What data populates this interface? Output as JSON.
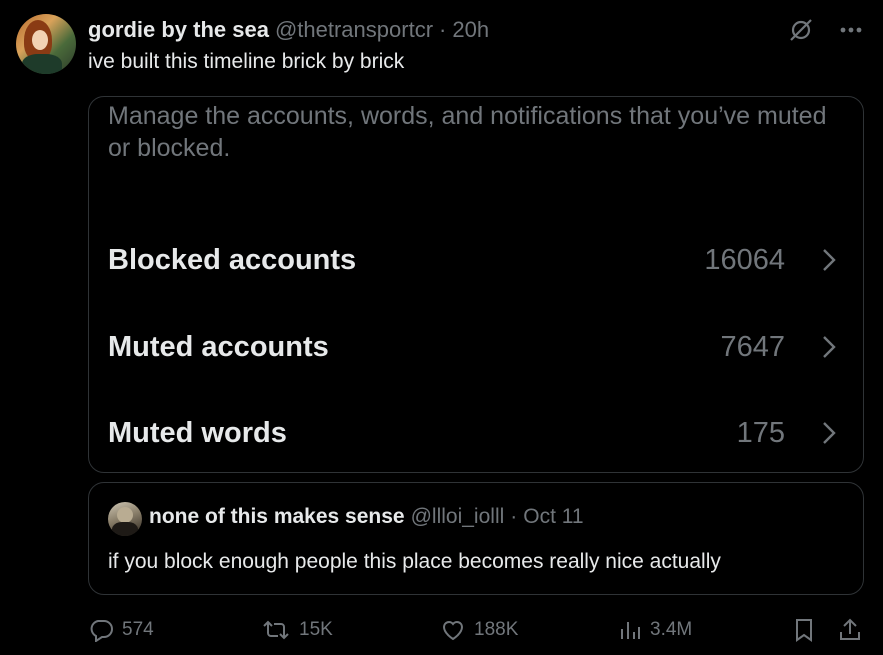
{
  "tweet": {
    "display_name": "gordie by the sea",
    "handle": "@thetransportcr",
    "separator": "·",
    "time": "20h",
    "text": "ive built this timeline brick by brick"
  },
  "card": {
    "description": "Manage the accounts, words, and notifications that you’ve muted or blocked.",
    "rows": [
      {
        "label": "Blocked accounts",
        "count": "16064"
      },
      {
        "label": "Muted accounts",
        "count": "7647"
      },
      {
        "label": "Muted words",
        "count": "175"
      }
    ]
  },
  "quote": {
    "display_name": "none of this makes sense",
    "handle": "@llloi_iolll",
    "separator": "·",
    "time": "Oct 11",
    "text": "if you block enough people this place becomes really nice actually"
  },
  "actions": {
    "replies": "574",
    "reposts": "15K",
    "likes": "188K",
    "views": "3.4M"
  },
  "icons": {
    "top_right": [
      "grok-icon",
      "more-icon"
    ],
    "actions": [
      "reply-icon",
      "repost-icon",
      "like-icon",
      "views-icon",
      "bookmark-icon",
      "share-icon"
    ]
  },
  "colors": {
    "background": "#000000",
    "text_primary": "#e7e9ea",
    "text_secondary": "#71767b",
    "border": "#2f3336"
  }
}
